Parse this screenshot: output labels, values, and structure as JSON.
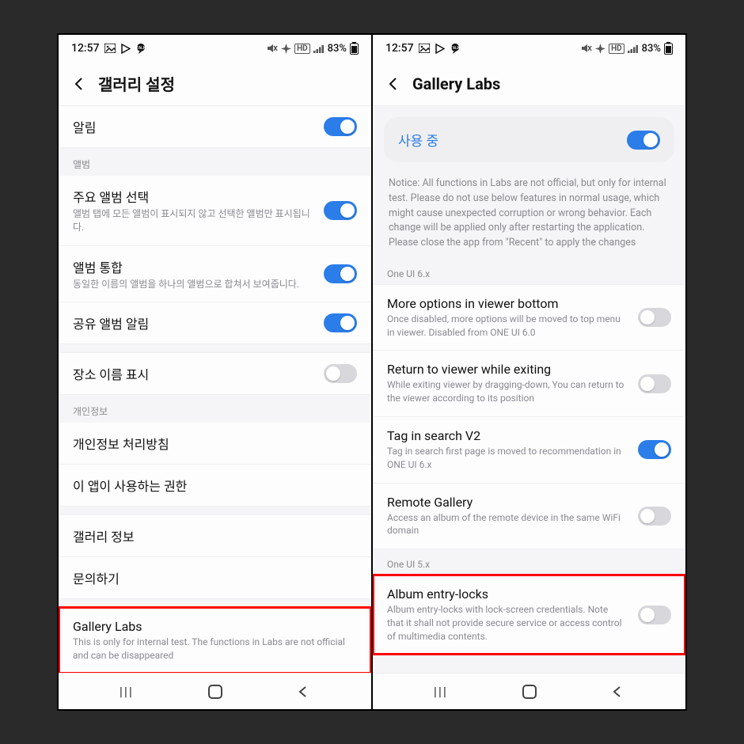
{
  "status": {
    "time": "12:57",
    "battery": "83%",
    "net_label": "HD",
    "indicators": [
      "image-icon",
      "play-icon",
      "chat-icon"
    ],
    "right_icons": [
      "mute-icon",
      "flight-mode-icon",
      "net-hd-icon",
      "signal-icon",
      "battery-icon"
    ]
  },
  "left": {
    "title": "갤러리 설정",
    "rows": {
      "notif": {
        "label": "알림",
        "on": true
      },
      "sec_album": "앨범",
      "main_album": {
        "label": "주요 앨범 선택",
        "sub": "앨범 탭에 모든 앨범이 표시되지 않고 선택한 앨범만 표시됩니다.",
        "on": true
      },
      "merge": {
        "label": "앨범 통합",
        "sub": "동일한 이름의 앨범을 하나의 앨범으로 합쳐서 보여줍니다.",
        "on": true
      },
      "share_notif": {
        "label": "공유 앨범 알림",
        "on": true
      },
      "place": {
        "label": "장소 이름 표시",
        "on": false
      },
      "sec_priv": "개인정보",
      "privacy": {
        "label": "개인정보 처리방침"
      },
      "perms": {
        "label": "이 앱이 사용하는 권한"
      },
      "info": {
        "label": "갤러리 정보"
      },
      "contact": {
        "label": "문의하기"
      },
      "labs": {
        "label": "Gallery Labs",
        "sub": "This is only for internal test. The functions in Labs are not official and can be disappeared"
      }
    }
  },
  "right": {
    "title": "Gallery Labs",
    "enabled_label": "사용 중",
    "enabled_on": true,
    "notice": "Notice: All functions in Labs are not official, but only for internal test. Please do not use below features in normal usage, which might cause unexpected corruption or wrong behavior. Each change will be applied only after restarting the application. Please close the app from \"Recent\" to apply the changes",
    "sec_6x": "One UI 6.x",
    "rows": {
      "more_opts": {
        "label": "More options in viewer bottom",
        "sub": "Once disabled, more options will be moved to top menu in viewer. Disabled from ONE UI 6.0",
        "on": false
      },
      "return_viewer": {
        "label": "Return to viewer while exiting",
        "sub": "While exiting viewer by dragging-down, You can return to the viewer according to its position",
        "on": false
      },
      "tag_v2": {
        "label": "Tag in search V2",
        "sub": "Tag in search first page is moved to recommendation in ONE UI 6.x",
        "on": true
      },
      "remote": {
        "label": "Remote Gallery",
        "sub": "Access an album of the remote device in the same WiFi domain",
        "on": false
      }
    },
    "sec_5x": "One UI 5.x",
    "album_lock": {
      "label": "Album entry-locks",
      "sub": "Album entry-locks with lock-screen credentials. Note that it shall not provide secure service or access control of multimedia contents.",
      "on": false
    }
  }
}
